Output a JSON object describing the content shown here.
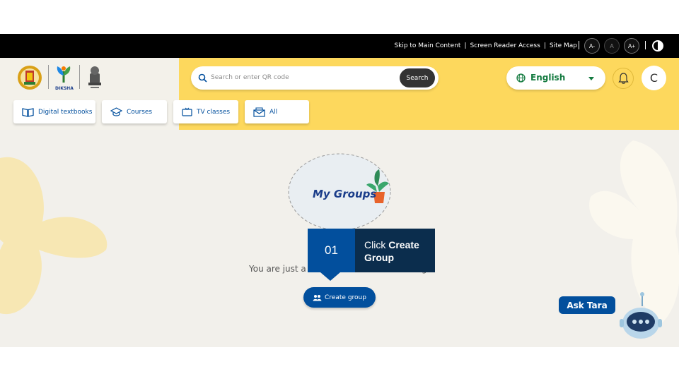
{
  "topbar": {
    "links": [
      "Skip to Main Content",
      "Screen Reader Access",
      "Site Map"
    ],
    "font_size_buttons": [
      "A-",
      "A",
      "A+"
    ],
    "contrast_icon": "contrast-icon"
  },
  "header": {
    "logos": [
      "tamil-nadu-emblem",
      "diksha-logo",
      "india-emblem"
    ],
    "diksha_label": "DIKSHA",
    "search": {
      "placeholder": "Search or enter QR code",
      "button_label": "Search",
      "icon": "search-icon"
    },
    "language": {
      "selected": "English",
      "icon": "globe-icon"
    },
    "notification_icon": "bell-icon",
    "avatar_initial": "C"
  },
  "nav": {
    "tabs": [
      {
        "label": "Digital textbooks",
        "icon": "book-icon"
      },
      {
        "label": "Courses",
        "icon": "graduation-cap-icon"
      },
      {
        "label": "TV classes",
        "icon": "tv-icon"
      },
      {
        "label": "All",
        "icon": "envelope-icon"
      }
    ]
  },
  "main": {
    "title": "My Groups",
    "subtitle": "You are just a s",
    "subtitle_tail": "g",
    "create_button": "Create group"
  },
  "callout": {
    "number": "01",
    "text_prefix": "Click ",
    "text_bold": "Create Group"
  },
  "assistant": {
    "label": "Ask Tara"
  },
  "colors": {
    "brand_blue": "#024f9d",
    "header_yellow": "#fdd85d",
    "callout_dark": "#0b2d4d",
    "language_green": "#137a3f"
  }
}
